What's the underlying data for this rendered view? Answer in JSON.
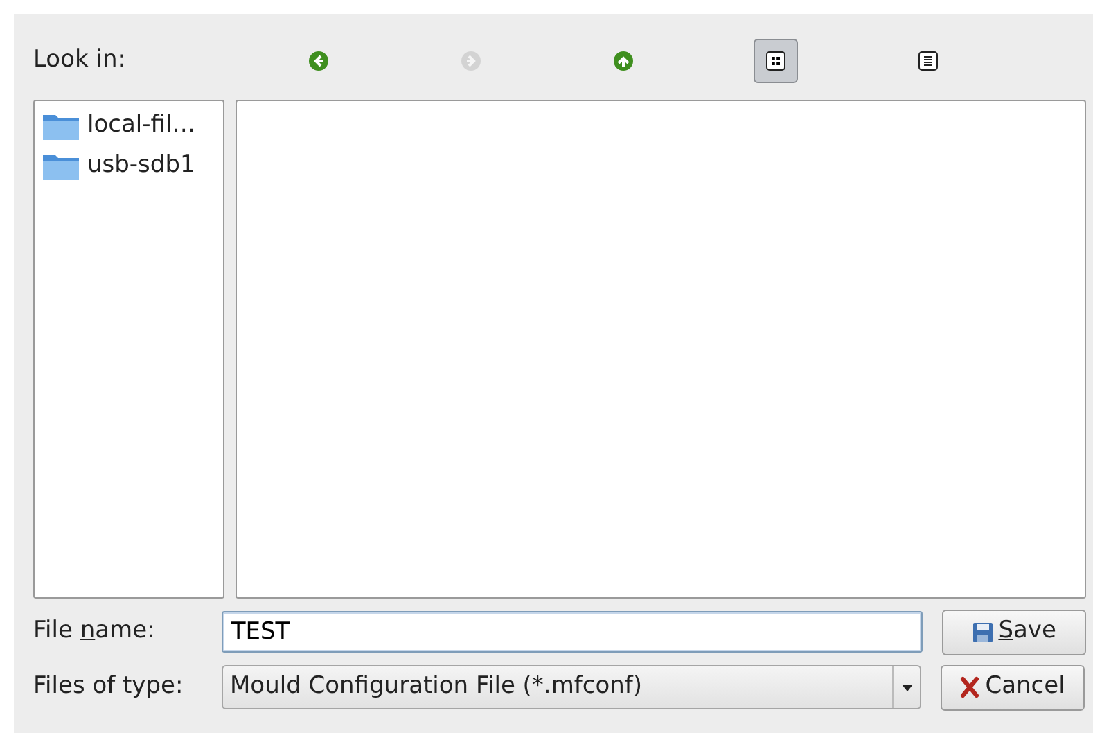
{
  "look_in": {
    "label": "Look in:"
  },
  "toolbar": [
    {
      "kind": "back",
      "disabled": false,
      "selected": false
    },
    {
      "kind": "forward",
      "disabled": true,
      "selected": false
    },
    {
      "kind": "up",
      "disabled": false,
      "selected": false
    },
    {
      "kind": "icon-view",
      "disabled": false,
      "selected": true
    },
    {
      "kind": "detail-view",
      "disabled": false,
      "selected": false
    }
  ],
  "sidebar": {
    "items": [
      {
        "label": "local-fil…"
      },
      {
        "label": "usb-sdb1"
      }
    ]
  },
  "file_name": {
    "label": {
      "prefix": "File ",
      "mnemonic": "n",
      "suffix": "ame:"
    },
    "value": "TEST"
  },
  "file_type": {
    "label": "Files of type:",
    "value": "Mould Configuration File (*.mfconf)"
  },
  "buttons": [
    {
      "kind": "save",
      "label": {
        "mnemonic": "S",
        "suffix": "ave"
      }
    },
    {
      "kind": "cancel",
      "label": {
        "suffix": "Cancel"
      }
    }
  ]
}
